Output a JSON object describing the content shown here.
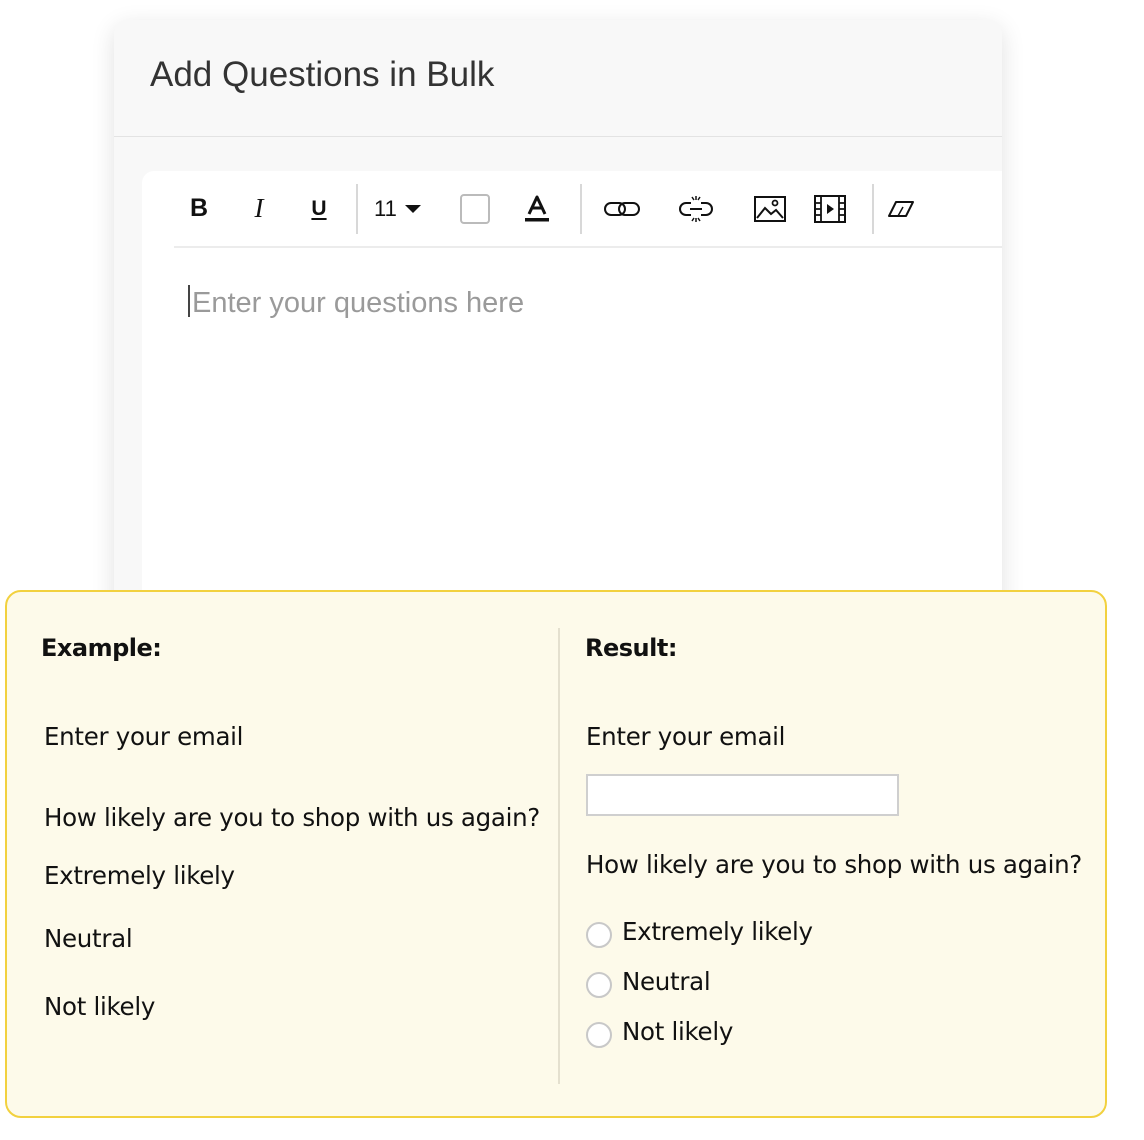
{
  "dialog": {
    "title": "Add Questions in Bulk"
  },
  "toolbar": {
    "bold": "B",
    "italic": "I",
    "underline": "U",
    "font_size": "11",
    "icons": [
      "bold-icon",
      "italic-icon",
      "underline-icon",
      "font-size-dropdown",
      "background-color-icon",
      "font-color-icon",
      "link-icon",
      "unlink-icon",
      "image-icon",
      "video-icon",
      "clear-format-icon"
    ]
  },
  "editor": {
    "placeholder": "Enter your questions here"
  },
  "example": {
    "heading": "Example:",
    "question1": "Enter your email",
    "question2": "How likely are you to shop with us again?",
    "options": [
      "Extremely likely",
      "Neutral",
      "Not likely"
    ]
  },
  "result": {
    "heading": "Result:",
    "question1": "Enter your email",
    "question2": "How likely are you to shop with us again?",
    "options": [
      "Extremely likely",
      "Neutral",
      "Not likely"
    ]
  },
  "colors": {
    "panel_background": "#fdfaea",
    "panel_border": "#f2d13f"
  }
}
